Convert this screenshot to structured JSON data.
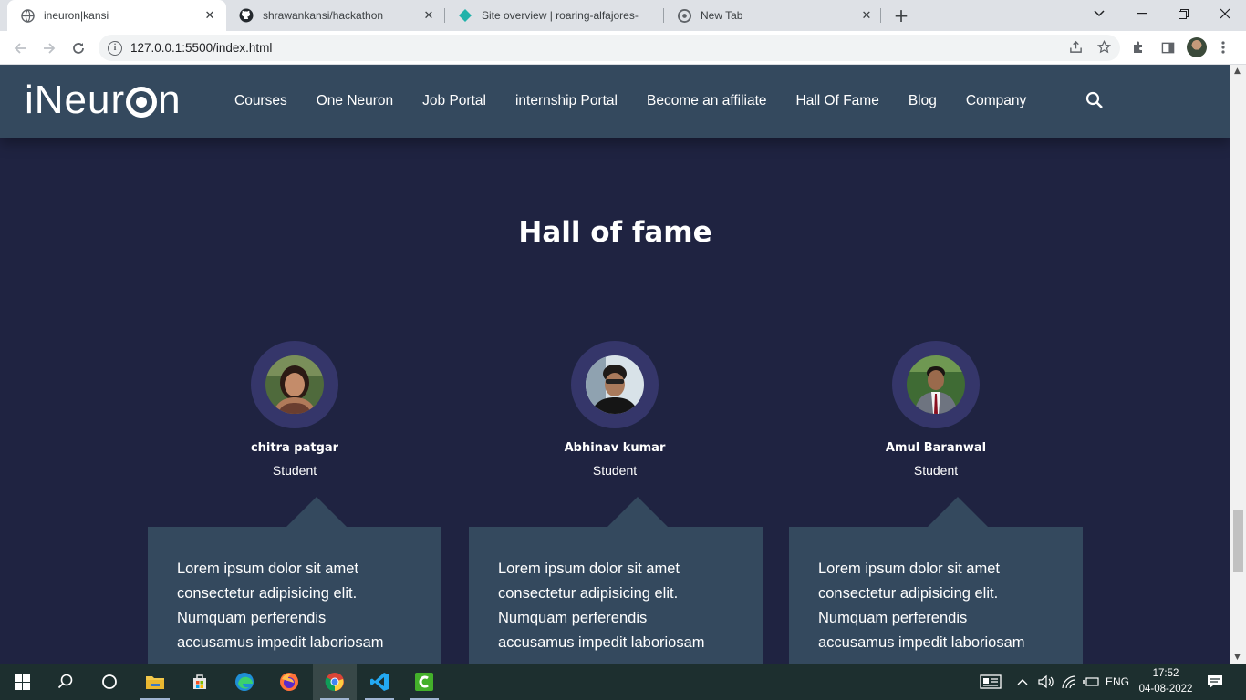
{
  "browser": {
    "tabs": [
      {
        "title": "ineuron|kansi",
        "icon": "globe-icon",
        "active": true
      },
      {
        "title": "shrawankansi/hackathon",
        "icon": "github-icon",
        "active": false
      },
      {
        "title": "Site overview | roaring-alfajores-",
        "icon": "netlify-icon",
        "active": false
      },
      {
        "title": "New Tab",
        "icon": "chrome-icon",
        "active": false
      }
    ],
    "url": "127.0.0.1:5500/index.html"
  },
  "site": {
    "logo": {
      "prefix": "iNeur",
      "suffix": "n"
    },
    "nav": [
      "Courses",
      "One Neuron",
      "Job Portal",
      "internship Portal",
      "Become an affiliate",
      "Hall Of Fame",
      "Blog",
      "Company"
    ],
    "accent_color": "#34495e",
    "page_background": "#1f2341"
  },
  "hall_of_fame": {
    "title": "Hall of fame",
    "members": [
      {
        "name": "chitra patgar",
        "role": "Student",
        "quote_lines": [
          "Lorem ipsum dolor sit amet",
          "consectetur adipisicing elit.",
          "Numquam perferendis",
          "accusamus impedit laboriosam"
        ]
      },
      {
        "name": "Abhinav kumar",
        "role": "Student",
        "quote_lines": [
          "Lorem ipsum dolor sit amet",
          "consectetur adipisicing elit.",
          "Numquam perferendis",
          "accusamus impedit laboriosam"
        ]
      },
      {
        "name": "Amul Baranwal",
        "role": "Student",
        "quote_lines": [
          "Lorem ipsum dolor sit amet",
          "consectetur adipisicing elit.",
          "Numquam perferendis",
          "accusamus impedit laboriosam"
        ]
      }
    ]
  },
  "taskbar": {
    "language": "ENG",
    "time": "17:52",
    "date": "04-08-2022"
  }
}
